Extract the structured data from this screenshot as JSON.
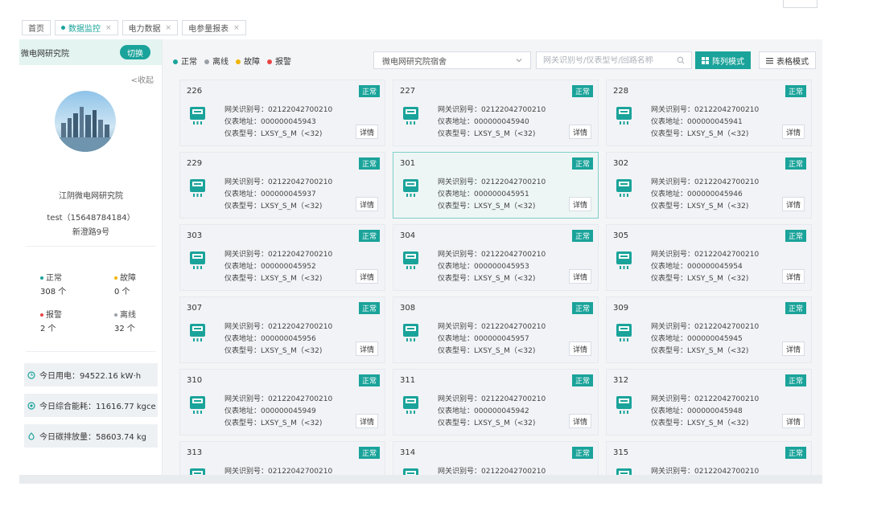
{
  "tabs": [
    {
      "label": "首页",
      "active": false,
      "closable": false
    },
    {
      "label": "数据监控",
      "active": true,
      "closable": true
    },
    {
      "label": "电力数据",
      "active": false,
      "closable": true
    },
    {
      "label": "电参量报表",
      "active": false,
      "closable": true
    }
  ],
  "tab_close_glyph": "×",
  "sidebar": {
    "org_title": "微电网研究院",
    "switch_label": "切换",
    "collapse_label": "<收起",
    "org_name": "江阴微电网研究院",
    "user": "test（15648784184）",
    "address": "新澄路9号",
    "stats": [
      {
        "label": "正常",
        "value": "308 个",
        "color": "#1aa39a"
      },
      {
        "label": "故障",
        "value": "0 个",
        "color": "#f0b400"
      },
      {
        "label": "报警",
        "value": "2 个",
        "color": "#e84545"
      },
      {
        "label": "离线",
        "value": "32 个",
        "color": "#9aa0a6"
      }
    ],
    "metrics": [
      {
        "label": "今日用电：94522.16 kW·h",
        "icon": "clock-icon"
      },
      {
        "label": "今日综合能耗：11616.77 kgce",
        "icon": "energy-icon"
      },
      {
        "label": "今日碳排放量：58603.74 kg",
        "icon": "carbon-icon"
      }
    ]
  },
  "legend": [
    {
      "label": "正常",
      "color": "#1aa39a"
    },
    {
      "label": "离线",
      "color": "#9aa0a6"
    },
    {
      "label": "故障",
      "color": "#f0b400"
    },
    {
      "label": "报警",
      "color": "#e84545"
    }
  ],
  "filter": {
    "selected_site": "微电网研究院宿舍",
    "search_placeholder": "网关识别号/仪表型号/回路名称",
    "grid_mode_label": "阵列模式",
    "table_mode_label": "表格模式"
  },
  "card_fields": {
    "gateway_prefix": "网关识别号：",
    "address_prefix": "仪表地址：",
    "model_prefix": "仪表型号："
  },
  "cards": [
    {
      "room": "226",
      "status": "正常",
      "gateway": "02122042700210",
      "address": "000000045943",
      "model": "LXSY_S_M（<32)",
      "detail": "详情"
    },
    {
      "room": "227",
      "status": "正常",
      "gateway": "02122042700210",
      "address": "000000045940",
      "model": "LXSY_S_M（<32)",
      "detail": "详情"
    },
    {
      "room": "228",
      "status": "正常",
      "gateway": "02122042700210",
      "address": "000000045941",
      "model": "LXSY_S_M（<32)",
      "detail": "详情"
    },
    {
      "room": "229",
      "status": "正常",
      "gateway": "02122042700210",
      "address": "000000045937",
      "model": "LXSY_S_M（<32)",
      "detail": "详情"
    },
    {
      "room": "301",
      "status": "正常",
      "gateway": "02122042700210",
      "address": "000000045951",
      "model": "LXSY_S_M（<32)",
      "detail": "详情",
      "selected": true
    },
    {
      "room": "302",
      "status": "正常",
      "gateway": "02122042700210",
      "address": "000000045946",
      "model": "LXSY_S_M（<32)",
      "detail": "详情"
    },
    {
      "room": "303",
      "status": "正常",
      "gateway": "02122042700210",
      "address": "000000045952",
      "model": "LXSY_S_M（<32)",
      "detail": "详情"
    },
    {
      "room": "304",
      "status": "正常",
      "gateway": "02122042700210",
      "address": "000000045953",
      "model": "LXSY_S_M（<32)",
      "detail": "详情"
    },
    {
      "room": "305",
      "status": "正常",
      "gateway": "02122042700210",
      "address": "000000045954",
      "model": "LXSY_S_M（<32)",
      "detail": "详情"
    },
    {
      "room": "307",
      "status": "正常",
      "gateway": "02122042700210",
      "address": "000000045956",
      "model": "LXSY_S_M（<32)",
      "detail": "详情"
    },
    {
      "room": "308",
      "status": "正常",
      "gateway": "02122042700210",
      "address": "000000045957",
      "model": "LXSY_S_M（<32)",
      "detail": "详情"
    },
    {
      "room": "309",
      "status": "正常",
      "gateway": "02122042700210",
      "address": "000000045945",
      "model": "LXSY_S_M（<32)",
      "detail": "详情"
    },
    {
      "room": "310",
      "status": "正常",
      "gateway": "02122042700210",
      "address": "000000045949",
      "model": "LXSY_S_M（<32)",
      "detail": "详情"
    },
    {
      "room": "311",
      "status": "正常",
      "gateway": "02122042700210",
      "address": "000000045942",
      "model": "LXSY_S_M（<32)",
      "detail": "详情"
    },
    {
      "room": "312",
      "status": "正常",
      "gateway": "02122042700210",
      "address": "000000045948",
      "model": "LXSY_S_M（<32)",
      "detail": "详情"
    },
    {
      "room": "313",
      "status": "正常",
      "gateway": "02122042700210"
    },
    {
      "room": "314",
      "status": "正常",
      "gateway": "02122042700210"
    },
    {
      "room": "315",
      "status": "正常",
      "gateway": "02122042700210"
    }
  ],
  "colors": {
    "accent": "#1aa39a",
    "card_bg": "#f1f3f6"
  }
}
